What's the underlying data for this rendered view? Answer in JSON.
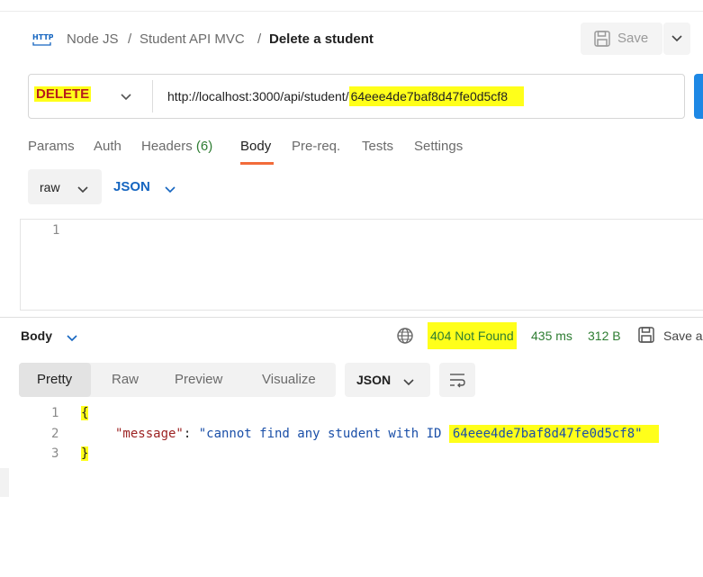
{
  "breadcrumb": {
    "icon": "http-icon",
    "items": [
      "Node JS",
      "/",
      "Student API MVC",
      "/"
    ],
    "current": "Delete a student"
  },
  "toolbar": {
    "save_label": "Save"
  },
  "request": {
    "method": "DELETE",
    "url_base": "http://localhost:3000/api/student/",
    "url_id": "64eee4de7baf8d47fe0d5cf8"
  },
  "request_tabs": [
    {
      "label": "Params"
    },
    {
      "label": "Auth"
    },
    {
      "label": "Headers",
      "count": "(6)"
    },
    {
      "label": "Body",
      "active": true
    },
    {
      "label": "Pre-req."
    },
    {
      "label": "Tests"
    },
    {
      "label": "Settings"
    }
  ],
  "body_mode": {
    "type": "raw",
    "format": "JSON"
  },
  "request_editor": {
    "lines": [
      "1"
    ]
  },
  "response": {
    "label": "Body",
    "status": "404 Not Found",
    "time": "435 ms",
    "size": "312 B",
    "save_label": "Save a",
    "view_tabs": [
      "Pretty",
      "Raw",
      "Preview",
      "Visualize"
    ],
    "active_view": "Pretty",
    "format": "JSON",
    "line_numbers": [
      "1",
      "2",
      "3"
    ],
    "open_brace": "{",
    "key": "\"message\"",
    "colon": ": ",
    "value_prefix": "\"cannot find any student with ID ",
    "value_id": "64eee4de7baf8d47fe0d5cf8\"",
    "close_brace": "}"
  },
  "colors": {
    "method": "#b71c1c",
    "status_ok_text": "#2e7d32",
    "active_tab_underline": "#f26b3a",
    "highlight": "#ffff1a",
    "json_key": "#9c2222",
    "json_string": "#1a4fa8"
  }
}
